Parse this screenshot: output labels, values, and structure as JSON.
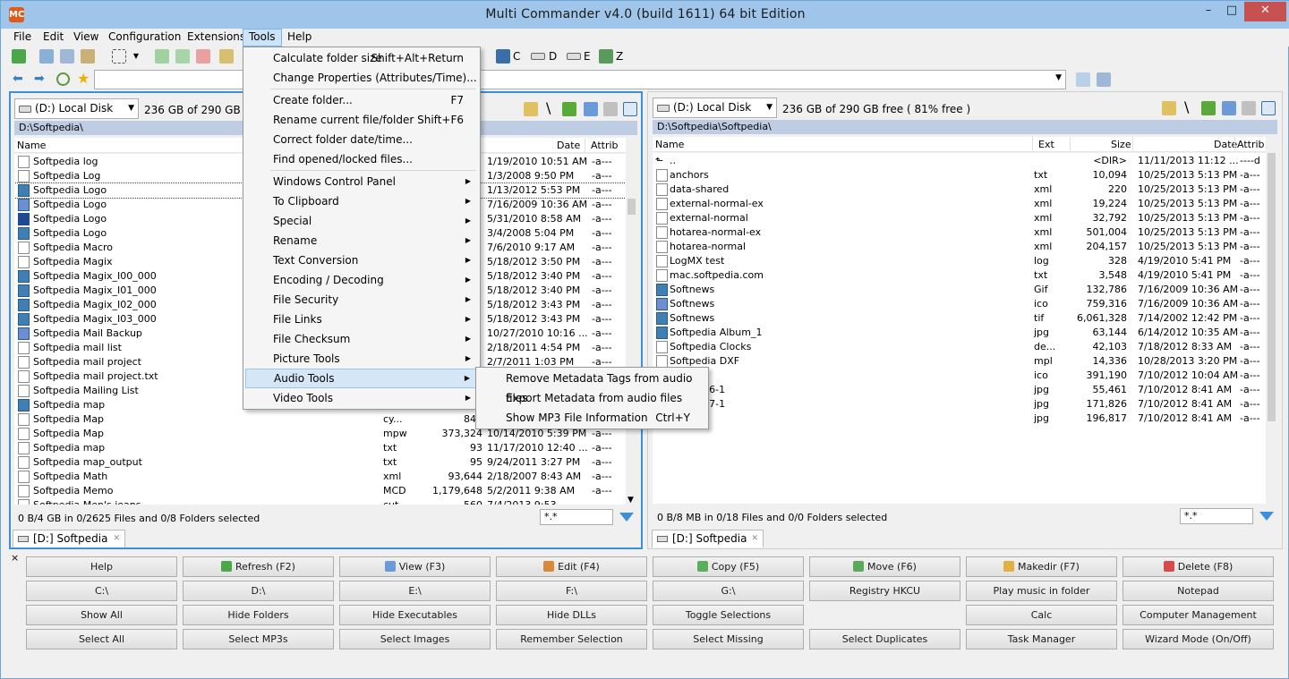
{
  "window": {
    "title": "Multi Commander v4.0 (build 1611) 64 bit Edition",
    "icon_label": "MC",
    "controls": [
      "–",
      "□",
      "✕"
    ]
  },
  "menubar": [
    "File",
    "Edit",
    "View",
    "Configuration",
    "Extensions",
    "Tools",
    "Help"
  ],
  "toolbar": {
    "drives": [
      "C",
      "D",
      "E",
      "Z"
    ]
  },
  "left_panel": {
    "drive": "(D:) Local Disk",
    "free": "236 GB of 290 GB free",
    "path": "D:\\Softpedia\\",
    "columns": {
      "name": "Name",
      "date": "Date",
      "attrib": "Attrib"
    },
    "rows": [
      {
        "name": "Softpedia log",
        "ext": "",
        "size": "",
        "date": "1/19/2010 10:51 AM",
        "attrib": "-a---",
        "icon": "file"
      },
      {
        "name": "Softpedia Log",
        "ext": "",
        "size": "",
        "date": "1/3/2008 9:50 PM",
        "attrib": "-a---",
        "icon": "file"
      },
      {
        "name": "Softpedia Logo",
        "ext": "",
        "size": "",
        "date": "1/13/2012 5:53 PM",
        "attrib": "-a---",
        "icon": "img"
      },
      {
        "name": "Softpedia Logo",
        "ext": "",
        "size": "",
        "date": "7/16/2009 10:36 AM",
        "attrib": "-a---",
        "icon": "ico"
      },
      {
        "name": "Softpedia Logo",
        "ext": "",
        "size": "",
        "date": "5/31/2010 8:58 AM",
        "attrib": "-a---",
        "icon": "s"
      },
      {
        "name": "Softpedia Logo",
        "ext": "",
        "size": "",
        "date": "3/4/2008 5:04 PM",
        "attrib": "-a---",
        "icon": "img"
      },
      {
        "name": "Softpedia Macro",
        "ext": "",
        "size": "",
        "date": "7/6/2010 9:17 AM",
        "attrib": "-a---",
        "icon": "file"
      },
      {
        "name": "Softpedia Magix",
        "ext": "",
        "size": "",
        "date": "5/18/2012 3:50 PM",
        "attrib": "-a---",
        "icon": "file"
      },
      {
        "name": "Softpedia Magix_I00_000",
        "ext": "",
        "size": "",
        "date": "5/18/2012 3:40 PM",
        "attrib": "-a---",
        "icon": "img"
      },
      {
        "name": "Softpedia Magix_I01_000",
        "ext": "",
        "size": "",
        "date": "5/18/2012 3:40 PM",
        "attrib": "-a---",
        "icon": "img"
      },
      {
        "name": "Softpedia Magix_I02_000",
        "ext": "",
        "size": "",
        "date": "5/18/2012 3:43 PM",
        "attrib": "-a---",
        "icon": "img"
      },
      {
        "name": "Softpedia Magix_I03_000",
        "ext": "",
        "size": "",
        "date": "5/18/2012 3:43 PM",
        "attrib": "-a---",
        "icon": "img"
      },
      {
        "name": "Softpedia Mail Backup",
        "ext": "",
        "size": "",
        "date": "10/27/2010 10:16 ...",
        "attrib": "-a---",
        "icon": "ico"
      },
      {
        "name": "Softpedia mail list",
        "ext": "",
        "size": "",
        "date": "2/18/2011 4:54 PM",
        "attrib": "-a---",
        "icon": "file"
      },
      {
        "name": "Softpedia mail project",
        "ext": "",
        "size": "",
        "date": "2/7/2011 1:03 PM",
        "attrib": "-a---",
        "icon": "file"
      },
      {
        "name": "Softpedia mail project.txt",
        "ext": "",
        "size": "",
        "date": "",
        "attrib": "",
        "icon": "file"
      },
      {
        "name": "Softpedia Mailing List",
        "ext": "",
        "size": "",
        "date": "",
        "attrib": "",
        "icon": "file"
      },
      {
        "name": "Softpedia map",
        "ext": "",
        "size": "",
        "date": "",
        "attrib": "",
        "icon": "img"
      },
      {
        "name": "Softpedia Map",
        "ext": "cy...",
        "size": "842",
        "date": "",
        "attrib": "",
        "icon": "file"
      },
      {
        "name": "Softpedia Map",
        "ext": "mpw",
        "size": "373,324",
        "date": "10/14/2010 5:39 PM",
        "attrib": "-a---",
        "icon": "file"
      },
      {
        "name": "Softpedia map",
        "ext": "txt",
        "size": "93",
        "date": "11/17/2010 12:40 ...",
        "attrib": "-a---",
        "icon": "file"
      },
      {
        "name": "Softpedia map_output",
        "ext": "txt",
        "size": "95",
        "date": "9/24/2011 3:27 PM",
        "attrib": "-a---",
        "icon": "file"
      },
      {
        "name": "Softpedia Math",
        "ext": "xml",
        "size": "93,644",
        "date": "2/18/2007 8:43 AM",
        "attrib": "-a---",
        "icon": "file"
      },
      {
        "name": "Softpedia Memo",
        "ext": "MCD",
        "size": "1,179,648",
        "date": "5/2/2011 9:38 AM",
        "attrib": "-a---",
        "icon": "file"
      },
      {
        "name": "Softpedia Men's jeans",
        "ext": "cut",
        "size": "560",
        "date": "7/4/2013 9:53 ...",
        "attrib": "",
        "icon": "file"
      }
    ],
    "status": "0 B/4 GB in 0/2625 Files and 0/8 Folders selected",
    "filter": "*.*",
    "tab": "[D:] Softpedia"
  },
  "right_panel": {
    "drive": "(D:) Local Disk",
    "free": "236 GB of 290 GB free ( 81% free )",
    "path": "D:\\Softpedia\\Softpedia\\",
    "columns": {
      "name": "Name",
      "ext": "Ext",
      "size": "Size",
      "date": "Date",
      "attrib": "Attrib"
    },
    "rows": [
      {
        "name": "..",
        "ext": "",
        "size": "<DIR>",
        "date": "11/11/2013 11:12 ...",
        "attrib": "----d",
        "icon": "up"
      },
      {
        "name": "anchors",
        "ext": "txt",
        "size": "10,094",
        "date": "10/25/2013 5:13 PM",
        "attrib": "-a---",
        "icon": "file"
      },
      {
        "name": "data-shared",
        "ext": "xml",
        "size": "220",
        "date": "10/25/2013 5:13 PM",
        "attrib": "-a---",
        "icon": "file"
      },
      {
        "name": "external-normal-ex",
        "ext": "xml",
        "size": "19,224",
        "date": "10/25/2013 5:13 PM",
        "attrib": "-a---",
        "icon": "file"
      },
      {
        "name": "external-normal",
        "ext": "xml",
        "size": "32,792",
        "date": "10/25/2013 5:13 PM",
        "attrib": "-a---",
        "icon": "file"
      },
      {
        "name": "hotarea-normal-ex",
        "ext": "xml",
        "size": "501,004",
        "date": "10/25/2013 5:13 PM",
        "attrib": "-a---",
        "icon": "file"
      },
      {
        "name": "hotarea-normal",
        "ext": "xml",
        "size": "204,157",
        "date": "10/25/2013 5:13 PM",
        "attrib": "-a---",
        "icon": "file"
      },
      {
        "name": "LogMX test",
        "ext": "log",
        "size": "328",
        "date": "4/19/2010 5:41 PM",
        "attrib": "-a---",
        "icon": "file"
      },
      {
        "name": "mac.softpedia.com",
        "ext": "txt",
        "size": "3,548",
        "date": "4/19/2010 5:41 PM",
        "attrib": "-a---",
        "icon": "file"
      },
      {
        "name": "Softnews",
        "ext": "Gif",
        "size": "132,786",
        "date": "7/16/2009 10:36 AM",
        "attrib": "-a---",
        "icon": "img"
      },
      {
        "name": "Softnews",
        "ext": "ico",
        "size": "759,316",
        "date": "7/16/2009 10:36 AM",
        "attrib": "-a---",
        "icon": "ico"
      },
      {
        "name": "Softnews",
        "ext": "tif",
        "size": "6,061,328",
        "date": "7/14/2002 12:42 PM",
        "attrib": "-a---",
        "icon": "img"
      },
      {
        "name": "Softpedia Album_1",
        "ext": "jpg",
        "size": "63,144",
        "date": "6/14/2012 10:35 AM",
        "attrib": "-a---",
        "icon": "img"
      },
      {
        "name": "Softpedia Clocks",
        "ext": "de...",
        "size": "42,103",
        "date": "7/18/2012 8:33 AM",
        "attrib": "-a---",
        "icon": "file"
      },
      {
        "name": "Softpedia DXF",
        "ext": "mpl",
        "size": "14,336",
        "date": "10/28/2013 3:20 PM",
        "attrib": "-a---",
        "icon": "file"
      },
      {
        "name": "Folder",
        "ext": "ico",
        "size": "391,190",
        "date": "7/10/2012 10:04 AM",
        "attrib": "-a---",
        "icon": "none"
      },
      {
        "name": "Images-6-1",
        "ext": "jpg",
        "size": "55,461",
        "date": "7/10/2012 8:41 AM",
        "attrib": "-a---",
        "icon": "none"
      },
      {
        "name": "Images-7-1",
        "ext": "jpg",
        "size": "171,826",
        "date": "7/10/2012 8:41 AM",
        "attrib": "-a---",
        "icon": "none"
      },
      {
        "name": "S2P-2-1",
        "ext": "jpg",
        "size": "196,817",
        "date": "7/10/2012 8:41 AM",
        "attrib": "-a---",
        "icon": "none"
      }
    ],
    "status": "0 B/8 MB in 0/18 Files and 0/0 Folders selected",
    "filter": "*.*",
    "tab": "[D:] Softpedia"
  },
  "tools_menu": {
    "items": [
      {
        "label": "Calculate folder size",
        "shortcut": "Shift+Alt+Return",
        "submenu": false
      },
      {
        "label": "Change Properties (Attributes/Time)...",
        "shortcut": "",
        "submenu": false
      },
      {
        "sep": true
      },
      {
        "label": "Create folder...",
        "shortcut": "F7",
        "submenu": false
      },
      {
        "label": "Rename current file/folder",
        "shortcut": "Shift+F6",
        "submenu": false
      },
      {
        "label": "Correct folder date/time...",
        "shortcut": "",
        "submenu": false
      },
      {
        "label": "Find opened/locked files...",
        "shortcut": "",
        "submenu": false
      },
      {
        "sep": true
      },
      {
        "label": "Windows Control Panel",
        "shortcut": "",
        "submenu": true
      },
      {
        "label": "To Clipboard",
        "shortcut": "",
        "submenu": true
      },
      {
        "label": "Special",
        "shortcut": "",
        "submenu": true
      },
      {
        "label": "Rename",
        "shortcut": "",
        "submenu": true
      },
      {
        "label": "Text Conversion",
        "shortcut": "",
        "submenu": true
      },
      {
        "label": "Encoding / Decoding",
        "shortcut": "",
        "submenu": true
      },
      {
        "label": "File Security",
        "shortcut": "",
        "submenu": true
      },
      {
        "label": "File Links",
        "shortcut": "",
        "submenu": true
      },
      {
        "label": "File Checksum",
        "shortcut": "",
        "submenu": true
      },
      {
        "label": "Picture Tools",
        "shortcut": "",
        "submenu": true
      },
      {
        "label": "Audio Tools",
        "shortcut": "",
        "submenu": true,
        "highlighted": true
      },
      {
        "label": "Video Tools",
        "shortcut": "",
        "submenu": true
      }
    ]
  },
  "audio_submenu": {
    "items": [
      {
        "label": "Remove Metadata Tags from audio files",
        "shortcut": ""
      },
      {
        "label": "Export Metadata from audio files",
        "shortcut": ""
      },
      {
        "label": "Show MP3 File Information",
        "shortcut": "Ctrl+Y"
      }
    ]
  },
  "button_bar": {
    "close_label": "×",
    "rows": [
      [
        {
          "label": "Help",
          "icon": ""
        },
        {
          "label": "Refresh (F2)",
          "icon": "refresh-icon"
        },
        {
          "label": "View (F3)",
          "icon": "view-icon"
        },
        {
          "label": "Edit (F4)",
          "icon": "edit-icon"
        },
        {
          "label": "Copy (F5)",
          "icon": "copy-icon"
        },
        {
          "label": "Move (F6)",
          "icon": "move-icon"
        },
        {
          "label": "Makedir (F7)",
          "icon": "folder-icon"
        },
        {
          "label": "Delete (F8)",
          "icon": "delete-icon"
        }
      ],
      [
        {
          "label": "C:\\",
          "icon": ""
        },
        {
          "label": "D:\\",
          "icon": ""
        },
        {
          "label": "E:\\",
          "icon": ""
        },
        {
          "label": "F:\\",
          "icon": ""
        },
        {
          "label": "G:\\",
          "icon": ""
        },
        {
          "label": "Registry HKCU",
          "icon": ""
        },
        {
          "label": "Play music in folder",
          "icon": ""
        },
        {
          "label": "Notepad",
          "icon": ""
        }
      ],
      [
        {
          "label": "Show All",
          "icon": ""
        },
        {
          "label": "Hide Folders",
          "icon": ""
        },
        {
          "label": "Hide Executables",
          "icon": ""
        },
        {
          "label": "Hide DLLs",
          "icon": ""
        },
        {
          "label": "Toggle Selections",
          "icon": ""
        },
        {
          "label": "Calc",
          "icon": ""
        },
        {
          "label": "Computer Management",
          "icon": ""
        }
      ],
      [
        {
          "label": "Select All",
          "icon": ""
        },
        {
          "label": "Select MP3s",
          "icon": ""
        },
        {
          "label": "Select Images",
          "icon": ""
        },
        {
          "label": "Remember Selection",
          "icon": ""
        },
        {
          "label": "Select Missing",
          "icon": ""
        },
        {
          "label": "Select Duplicates",
          "icon": ""
        },
        {
          "label": "Task Manager",
          "icon": ""
        },
        {
          "label": "Wizard Mode (On/Off)",
          "icon": ""
        }
      ]
    ]
  },
  "colors": {
    "title_bg": "#9fc6ea",
    "active_panel_border": "#3c8fd9",
    "path_bar": "#bfcde4",
    "menu_highlight": "#d5e6f7",
    "close_button": "#c75050"
  }
}
